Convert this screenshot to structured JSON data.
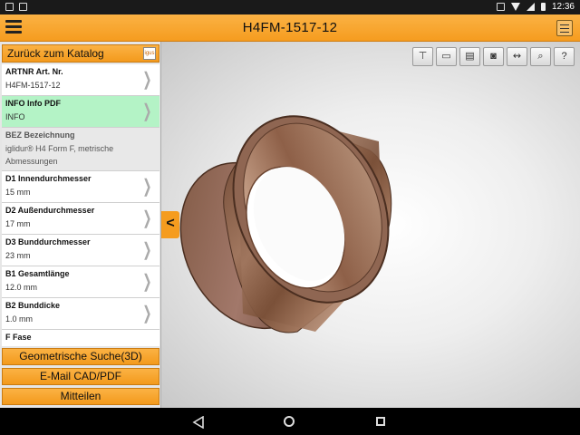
{
  "status": {
    "time": "12:36"
  },
  "header": {
    "title": "H4FM-1517-12"
  },
  "panel": {
    "back_label": "Zurück zum Katalog",
    "rows": [
      {
        "key": "ARTNR Art. Nr.",
        "value": "H4FM-1517-12"
      },
      {
        "key": "INFO Info PDF",
        "value": "INFO"
      },
      {
        "key": "BEZ Bezeichnung",
        "value": "iglidur® H4 Form F, metrische Abmessungen"
      },
      {
        "key": "D1 Innendurchmesser",
        "value": "15 mm"
      },
      {
        "key": "D2 Außendurchmesser",
        "value": "17 mm"
      },
      {
        "key": "D3 Bunddurchmesser",
        "value": "23 mm"
      },
      {
        "key": "B1 Gesamtlänge",
        "value": "12.0 mm"
      },
      {
        "key": "B2 Bunddicke",
        "value": "1.0 mm"
      },
      {
        "key": "F Fase",
        "value": ""
      }
    ],
    "actions": [
      "Geometrische Suche(3D)",
      "E-Mail CAD/PDF",
      "Mitteilen"
    ]
  },
  "viewport": {
    "collapse_label": "<",
    "tools": [
      "dimension-icon",
      "layers-icon",
      "pdf-icon",
      "camera-icon",
      "measure-icon",
      "zoom-icon",
      "help-icon"
    ]
  },
  "colors": {
    "accent": "#f59c1f",
    "selected_row": "#b4f3c6",
    "part": "#8a5a3c"
  }
}
